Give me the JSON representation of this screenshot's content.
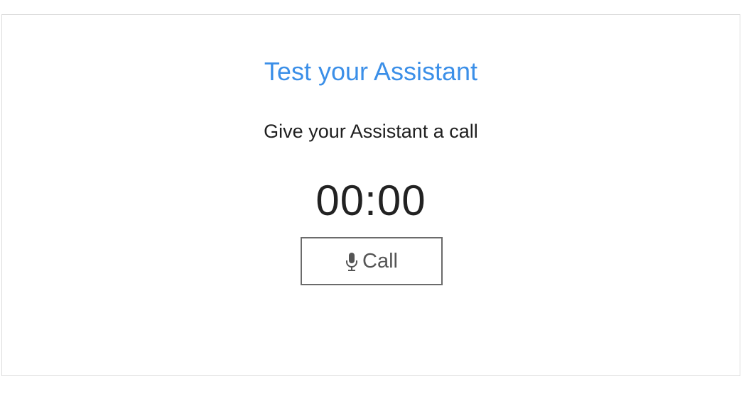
{
  "card": {
    "title": "Test your Assistant",
    "subtitle": "Give your Assistant a call",
    "timer": "00:00",
    "call_button": {
      "label": "Call",
      "icon": "microphone-icon"
    }
  },
  "colors": {
    "title": "#3b8fe8",
    "text": "#1f1f1f",
    "button_border": "#6b6b6b",
    "button_text": "#555555",
    "panel_border": "#dcdcdc"
  }
}
